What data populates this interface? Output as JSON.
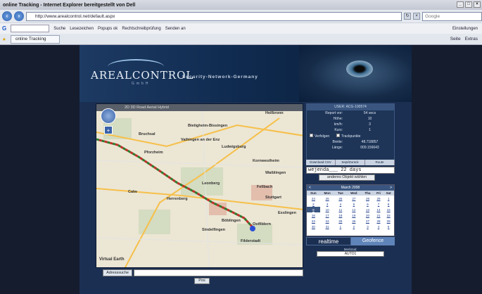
{
  "browser": {
    "title": "online Tracking - Internet Explorer bereitgestellt von Dell",
    "address": "http://www.arealcontrol.net/default.aspx",
    "search_placeholder": "Google",
    "google_bar": [
      "G",
      "Suche",
      "Lesezeichen",
      "Popups ok",
      "Rechtschreibprüfung",
      "Senden an",
      "Einstellungen"
    ],
    "tab_label": "online Tracking",
    "tab_tools": [
      "Seite",
      "Extras"
    ]
  },
  "header": {
    "logo": "AREALCONTROL",
    "logo_sub": "GmbH",
    "slogan": "Security-Network-Germany"
  },
  "map": {
    "top_links": "2D  3D  Road  Aerial  Hybrid",
    "brand": "Virtual Earth",
    "cities": [
      {
        "name": "Bruchsal"
      },
      {
        "name": "Pforzheim"
      },
      {
        "name": "Ludwigsburg"
      },
      {
        "name": "Waiblingen"
      },
      {
        "name": "Stuttgart"
      },
      {
        "name": "Böblingen"
      },
      {
        "name": "Sindelfingen"
      },
      {
        "name": "Esslingen"
      },
      {
        "name": "Leonberg"
      },
      {
        "name": "Heilbronn"
      },
      {
        "name": "Vaihingen an der Enz"
      },
      {
        "name": "Bietigheim-Bissingen"
      },
      {
        "name": "Herrenberg"
      },
      {
        "name": "Ostfildern"
      },
      {
        "name": "Filderstadt"
      },
      {
        "name": "Kornwestheim"
      },
      {
        "name": "Fellbach"
      },
      {
        "name": "Calw"
      }
    ],
    "address_search_label": "Adresssuche",
    "pos_button": "Pos"
  },
  "panel": {
    "user": "USER: ACG-100574",
    "rows": [
      {
        "k": "Report vor:",
        "v": "54 secs"
      },
      {
        "k": "Höhe:",
        "v": "10"
      },
      {
        "k": "km/h:",
        "v": "3"
      },
      {
        "k": "Kurs:",
        "v": "1"
      }
    ],
    "check1": "Verfolgen",
    "check2": "Trackpunkte",
    "lat_label": "Breite:",
    "lat": "48.718857",
    "lon_label": "Länge:",
    "lon": "009.156643",
    "tabs": [
      "Download CSV",
      "Sept/Zurück",
      "Route"
    ],
    "select_value": "wejenda___  22 days",
    "select_button": "anderes Objekt wählen"
  },
  "calendar": {
    "month": "March 2008",
    "prev": "<",
    "next": ">",
    "days": [
      "Sun",
      "Mon",
      "Tue",
      "Wed",
      "Thu",
      "Fri",
      "Sat"
    ],
    "weeks": [
      [
        "24",
        "25",
        "26",
        "27",
        "28",
        "29",
        "1"
      ],
      [
        "2",
        "3",
        "4",
        "5",
        "6",
        "7",
        "8"
      ],
      [
        "9",
        "10",
        "11",
        "12",
        "13",
        "14",
        "15"
      ],
      [
        "16",
        "17",
        "18",
        "19",
        "20",
        "21",
        "22"
      ],
      [
        "23",
        "24",
        "25",
        "26",
        "27",
        "28",
        "29"
      ],
      [
        "30",
        "31",
        "1",
        "2",
        "3",
        "4",
        "5"
      ]
    ]
  },
  "modes": {
    "realtime": "realtime",
    "geofence": "Geofence"
  },
  "marker": {
    "label": "Merkmal:",
    "value": "AUTO1"
  }
}
